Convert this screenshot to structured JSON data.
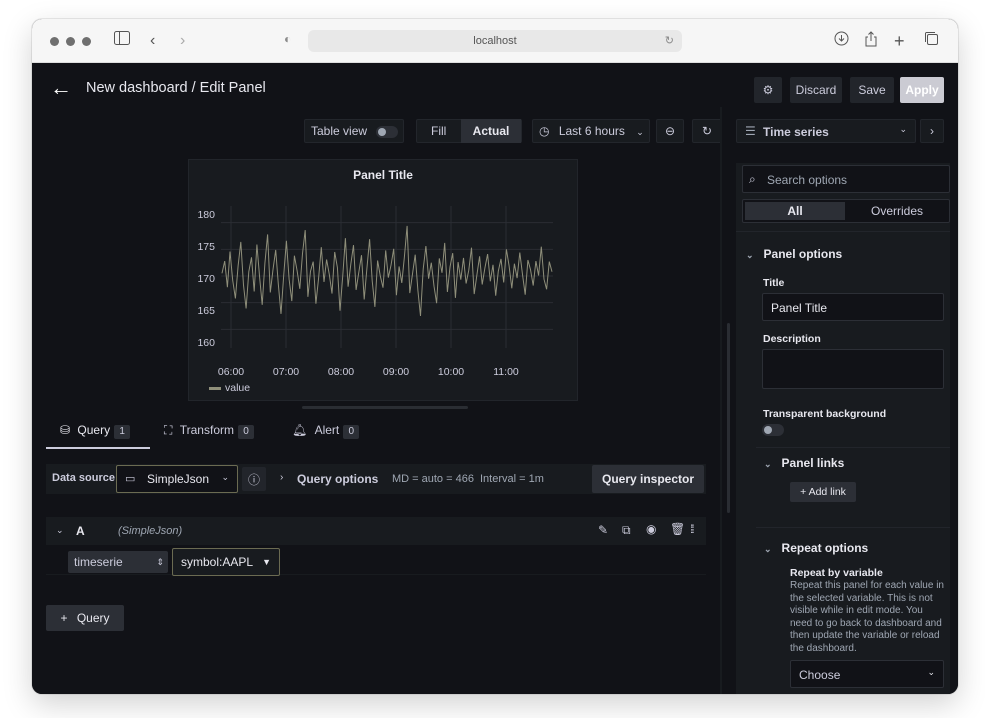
{
  "browser": {
    "url": "localhost"
  },
  "header": {
    "title": "New dashboard / Edit Panel",
    "discard": "Discard",
    "save": "Save",
    "apply": "Apply"
  },
  "toolbar": {
    "table_view": "Table view",
    "fill": "Fill",
    "actual": "Actual",
    "time_range": "Last 6 hours",
    "visualization": "Time series"
  },
  "panel": {
    "title": "Panel Title",
    "legend": "value"
  },
  "chart_data": {
    "type": "line",
    "title": "Panel Title",
    "ylim": [
      158,
      182
    ],
    "y_ticks": [
      "180",
      "175",
      "170",
      "165",
      "160"
    ],
    "x_ticks": [
      "06:00",
      "07:00",
      "08:00",
      "09:00",
      "10:00",
      "11:00"
    ],
    "grid": true,
    "legend_position": "bottom-left",
    "series": [
      {
        "name": "value",
        "color": "#8f8f7a",
        "values": [
          170.5,
          172.8,
          167.9,
          174.6,
          169.2,
          165.8,
          171.9,
          176.4,
          168.3,
          163.9,
          170.8,
          173.5,
          167.1,
          175.9,
          169.8,
          164.6,
          172.4,
          177.8,
          166.9,
          171.2,
          174.9,
          168.5,
          162.9,
          170.1,
          176.6,
          169.4,
          165.3,
          173.8,
          171.0,
          167.6,
          174.2,
          178.6,
          166.1,
          170.9,
          172.7,
          164.8,
          169.6,
          175.4,
          168.9,
          173.1,
          170.3,
          166.7,
          174.5,
          171.6,
          163.5,
          169.9,
          177.1,
          168.0,
          172.2,
          175.8,
          167.4,
          170.7,
          173.9,
          165.6,
          171.4,
          176.9,
          169.1,
          164.2,
          172.9,
          170.0,
          167.8,
          174.8,
          169.7,
          172.0,
          175.1,
          166.4,
          171.8,
          168.7,
          173.6,
          179.4,
          166.8,
          170.4,
          174.0,
          167.3,
          162.5,
          171.3,
          175.6,
          169.5,
          172.5,
          168.1,
          164.9,
          173.3,
          170.6,
          176.2,
          167.0,
          171.7,
          174.3,
          165.9,
          172.6,
          169.3,
          173.4,
          168.6,
          171.1,
          175.3,
          166.6,
          170.2,
          173.7,
          168.4,
          171.5,
          174.1,
          169.0,
          172.1,
          166.3,
          170.9,
          173.2,
          168.8,
          175.0,
          171.9,
          167.7,
          172.3,
          169.6,
          174.4,
          170.3,
          166.5,
          173.0,
          171.2,
          168.2,
          172.8,
          170.1,
          175.5,
          169.4,
          167.5,
          172.7,
          170.8
        ]
      }
    ]
  },
  "query_tabs": [
    {
      "label": "Query",
      "count": "1"
    },
    {
      "label": "Transform",
      "count": "0"
    },
    {
      "label": "Alert",
      "count": "0"
    }
  ],
  "query_row": {
    "data_source_label": "Data source",
    "data_source": "SimpleJson",
    "query_options": "Query options",
    "md": "MD = auto = 466",
    "interval": "Interval = 1m",
    "inspector": "Query inspector"
  },
  "query_a": {
    "ref": "A",
    "source": "(SimpleJson)",
    "type": "timeserie",
    "target": "symbol:AAPL"
  },
  "add_query": "Query",
  "options": {
    "search_placeholder": "Search options",
    "tab_all": "All",
    "tab_overrides": "Overrides",
    "panel_options": "Panel options",
    "title_label": "Title",
    "title_value": "Panel Title",
    "description_label": "Description",
    "transparent_label": "Transparent background",
    "panel_links": "Panel links",
    "add_link": "Add link",
    "repeat_options": "Repeat options",
    "repeat_by_variable": "Repeat by variable",
    "repeat_help": "Repeat this panel for each value in the selected variable. This is not visible while in edit mode. You need to go back to dashboard and then update the variable or reload the dashboard.",
    "choose": "Choose"
  }
}
